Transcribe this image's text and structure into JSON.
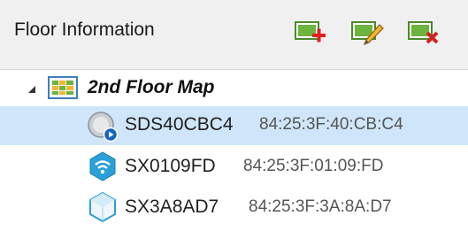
{
  "header": {
    "title": "Floor Information",
    "buttons": [
      {
        "name": "add-floor-button",
        "icon": "map-add-icon"
      },
      {
        "name": "edit-floor-button",
        "icon": "map-edit-icon"
      },
      {
        "name": "delete-floor-button",
        "icon": "map-delete-icon"
      }
    ]
  },
  "tree": {
    "floor": {
      "label": "2nd Floor Map",
      "expanded": true,
      "icon": "floor-map-icon"
    },
    "devices": [
      {
        "name": "SDS40CBC4",
        "mac": "84:25:3F:40:CB:C4",
        "icon": "sensor-disk-icon",
        "selected": true
      },
      {
        "name": "SX0109FD",
        "mac": "84:25:3F:01:09:FD",
        "icon": "wifi-hexagon-icon",
        "selected": false
      },
      {
        "name": "SX3A8AD7",
        "mac": "84:25:3F:3A:8A:D7",
        "icon": "hexagon-device-icon",
        "selected": false
      }
    ]
  },
  "colors": {
    "selection": "#cfe6fa",
    "header_bg": "#f0f0f0",
    "green": "#6cb33f",
    "hex_blue": "#2a9fd8",
    "delete_red": "#d42020",
    "add_red": "#e02020"
  }
}
